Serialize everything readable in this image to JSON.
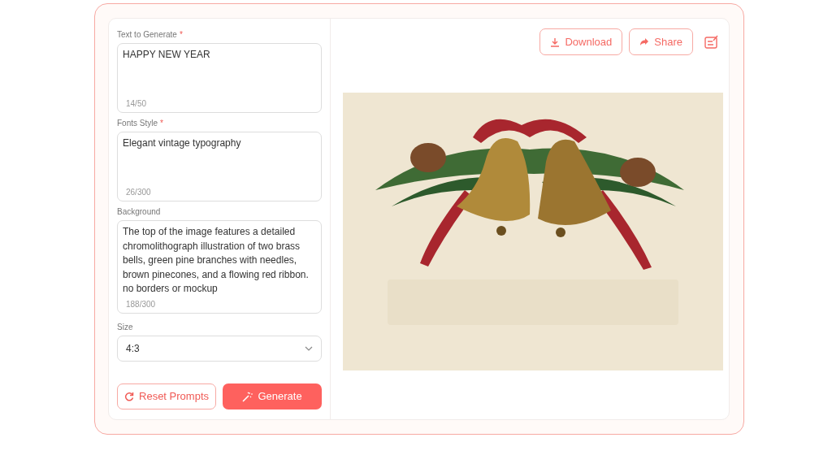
{
  "fields": [
    {
      "label": "Text to Generate",
      "required_mark": "*",
      "value": "HAPPY NEW YEAR",
      "counter": "14/50"
    },
    {
      "label": "Fonts Style",
      "required_mark": "*",
      "value": "Elegant vintage typography",
      "counter": "26/300"
    },
    {
      "label": "Background",
      "value": "The top of the image features a detailed chromolithograph illustration of two brass bells, green pine branches with needles, brown pinecones, and a flowing red ribbon. no borders or mockup",
      "counter": "188/300"
    }
  ],
  "size": {
    "label": "Size",
    "value": "4:3"
  },
  "buttons": [
    {
      "label": "Reset Prompts",
      "kind": "outline"
    },
    {
      "label": "Generate",
      "kind": "primary"
    }
  ],
  "actions": [
    {
      "label": "Download",
      "kind": "download"
    },
    {
      "label": "Share",
      "kind": "share"
    }
  ]
}
